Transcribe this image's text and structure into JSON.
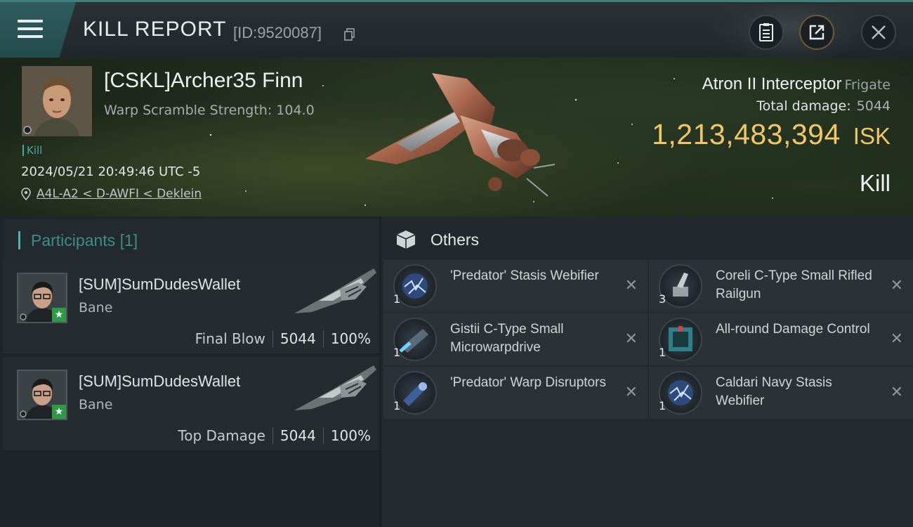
{
  "header": {
    "title": "KILL REPORT",
    "kill_id": "[ID:9520087]"
  },
  "victim": {
    "name": "[CSKL]Archer35 Finn",
    "scramble_label": "Warp Scramble Strength: 104.0",
    "kill_tag": "Kill",
    "time": "2024/05/21 20:49:46 UTC -5",
    "location": "A4L-A2 < D-AWFI < Deklein",
    "ship_name": "Atron II Interceptor",
    "ship_class": "Frigate",
    "total_damage_label": "Total damage:",
    "total_damage": "5044",
    "isk_value": "1,213,483,394",
    "isk_unit": "ISK",
    "result": "Kill"
  },
  "participants": {
    "title": "Participants",
    "count": "[1]",
    "rows": [
      {
        "name": "[SUM]SumDudesWallet",
        "ship": "Bane",
        "label": "Final Blow",
        "damage": "5044",
        "percent": "100%"
      },
      {
        "name": "[SUM]SumDudesWallet",
        "ship": "Bane",
        "label": "Top Damage",
        "damage": "5044",
        "percent": "100%"
      }
    ]
  },
  "others": {
    "title": "Others",
    "items": [
      {
        "qty": "1",
        "name": "'Predator' Stasis Webifier",
        "icon": "stasis-webifier-icon"
      },
      {
        "qty": "3",
        "name": "Coreli C-Type Small Rifled Railgun",
        "icon": "railgun-icon"
      },
      {
        "qty": "1",
        "name": "Gistii C-Type Small Microwarpdrive",
        "icon": "microwarpdrive-icon"
      },
      {
        "qty": "1",
        "name": "All-round Damage Control",
        "icon": "damage-control-icon"
      },
      {
        "qty": "1",
        "name": "'Predator' Warp Disruptors",
        "icon": "warp-disruptor-icon"
      },
      {
        "qty": "1",
        "name": "Caldari Navy Stasis Webifier",
        "icon": "stasis-webifier-icon"
      }
    ]
  },
  "colors": {
    "accent_teal": "#4fb2ac",
    "isk_gold": "#f1c765",
    "star_green": "#2e9a46"
  }
}
